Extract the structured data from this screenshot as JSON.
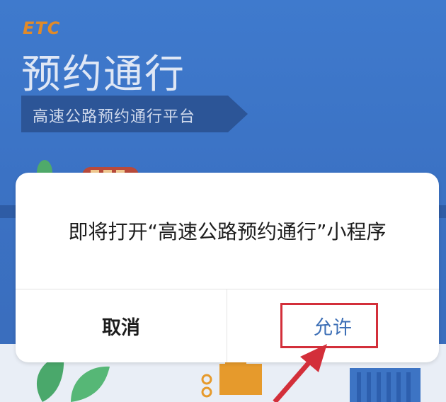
{
  "background": {
    "logo_text": "ETC",
    "title": "预约通行",
    "banner_text": "高速公路预约通行平台"
  },
  "dialog": {
    "message": "即将打开“高速公路预约通行”小程序",
    "cancel_label": "取消",
    "allow_label": "允许"
  },
  "annotation": {
    "highlight_color": "#d32f3a",
    "target": "allow-button"
  },
  "colors": {
    "background_blue": "#3a6fc0",
    "accent_blue": "#3d6fb6",
    "logo_orange": "#e08a2a"
  }
}
